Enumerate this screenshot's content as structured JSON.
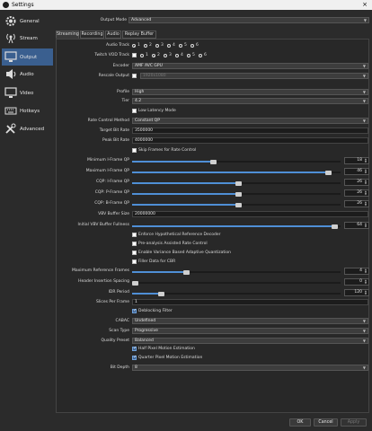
{
  "window": {
    "title": "Settings",
    "close": "×"
  },
  "sidebar": {
    "items": [
      {
        "label": "General",
        "icon": "gear-icon"
      },
      {
        "label": "Stream",
        "icon": "stream-icon"
      },
      {
        "label": "Output",
        "icon": "monitor-icon"
      },
      {
        "label": "Audio",
        "icon": "speaker-icon"
      },
      {
        "label": "Video",
        "icon": "monitor-icon"
      },
      {
        "label": "Hotkeys",
        "icon": "keyboard-icon"
      },
      {
        "label": "Advanced",
        "icon": "wrench-icon"
      }
    ]
  },
  "output": {
    "mode_label": "Output Mode",
    "mode_value": "Advanced",
    "tabs": [
      "Streaming",
      "Recording",
      "Audio",
      "Replay Buffer"
    ],
    "audio_track_label": "Audio Track",
    "twitch_vod_label": "Twitch VOD Track",
    "tracks": [
      "1",
      "2",
      "3",
      "4",
      "5",
      "6"
    ],
    "encoder_label": "Encoder",
    "encoder_value": "AMF AVC GPU",
    "rescale_label": "Rescale Output",
    "rescale_value": "1920x1080"
  },
  "settings": {
    "profile_label": "Profile",
    "profile_value": "High",
    "tier_label": "Tier",
    "tier_value": "4.2",
    "low_latency_label": "Low Latency Mode",
    "rate_control_label": "Rate Control Method",
    "rate_control_value": "Constant QP",
    "target_bitrate_label": "Target Bit Rate",
    "target_bitrate_value": "3500000",
    "peak_bitrate_label": "Peak Bit Rate",
    "peak_bitrate_value": "4000000",
    "skip_frames_label": "Skip Frames for Rate Control",
    "min_qp_label": "Minimum I-Frame QP",
    "min_qp_value": "18",
    "min_qp_level": 0.39,
    "max_qp_label": "Maximum I-Frame QP",
    "max_qp_value": "46",
    "max_qp_level": 0.94,
    "cqp_i_label": "CQP: I-Frame QP",
    "cqp_i_value": "26",
    "cqp_i_level": 0.51,
    "cqp_p_label": "CQP: P-Frame QP",
    "cqp_p_value": "26",
    "cqp_p_level": 0.51,
    "cqp_b_label": "CQP: B-Frame QP",
    "cqp_b_value": "26",
    "cqp_b_level": 0.51,
    "vbv_size_label": "VBV Buffer Size",
    "vbv_size_value": "20000000",
    "vbv_full_label": "Initial VBV Buffer Fullness",
    "vbv_full_value": "64",
    "vbv_full_level": 0.97,
    "enforce_hrd_label": "Enforce Hypothetical Reference Decoder",
    "preanalysis_label": "Pre-analysis Assisted Rate Control",
    "vbaq_label": "Enable Variance Based Adaptive Quantization",
    "filler_label": "Filler Data for CBR",
    "max_ref_label": "Maximum Reference Frames",
    "max_ref_value": "4",
    "max_ref_level": 0.26,
    "header_spacing_label": "Header Insertion Spacing",
    "header_spacing_value": "0",
    "header_spacing_level": 0.0,
    "idr_label": "IDR Period",
    "idr_value": "120",
    "idr_level": 0.14,
    "slices_label": "Slices Per Frame",
    "slices_value": "1",
    "deblocking_label": "Deblocking Filter",
    "cabac_label": "CABAC",
    "cabac_value": "Undefined",
    "scan_type_label": "Scan Type",
    "scan_type_value": "Progressive",
    "quality_preset_label": "Quality Preset",
    "quality_preset_value": "Balanced",
    "half_pixel_label": "Half Pixel Motion Estimation",
    "quarter_pixel_label": "Quarter Pixel Motion Estimation",
    "bit_depth_label": "Bit Depth",
    "bit_depth_value": "8"
  },
  "buttons": {
    "ok": "OK",
    "cancel": "Cancel",
    "apply": "Apply"
  },
  "colors": {
    "accent": "#4f8fd6",
    "selected": "#3a5f8f",
    "background": "#2b2b2b"
  }
}
